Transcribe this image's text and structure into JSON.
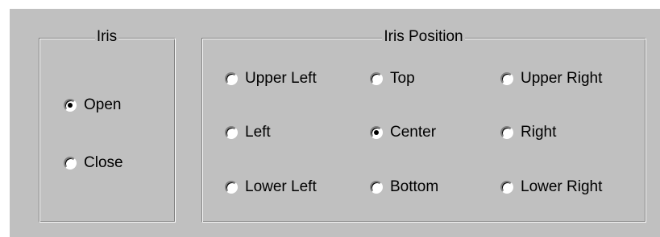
{
  "iris_group": {
    "title": "Iris",
    "options": [
      {
        "label": "Open",
        "checked": true
      },
      {
        "label": "Close",
        "checked": false
      }
    ]
  },
  "position_group": {
    "title": "Iris Position",
    "options": [
      {
        "label": "Upper Left",
        "checked": false
      },
      {
        "label": "Top",
        "checked": false
      },
      {
        "label": "Upper Right",
        "checked": false
      },
      {
        "label": "Left",
        "checked": false
      },
      {
        "label": "Center",
        "checked": true
      },
      {
        "label": "Right",
        "checked": false
      },
      {
        "label": "Lower Left",
        "checked": false
      },
      {
        "label": "Bottom",
        "checked": false
      },
      {
        "label": "Lower Right",
        "checked": false
      }
    ]
  },
  "colors": {
    "face": "#c0c0c0",
    "shadow": "#808080",
    "highlight": "#ffffff"
  }
}
